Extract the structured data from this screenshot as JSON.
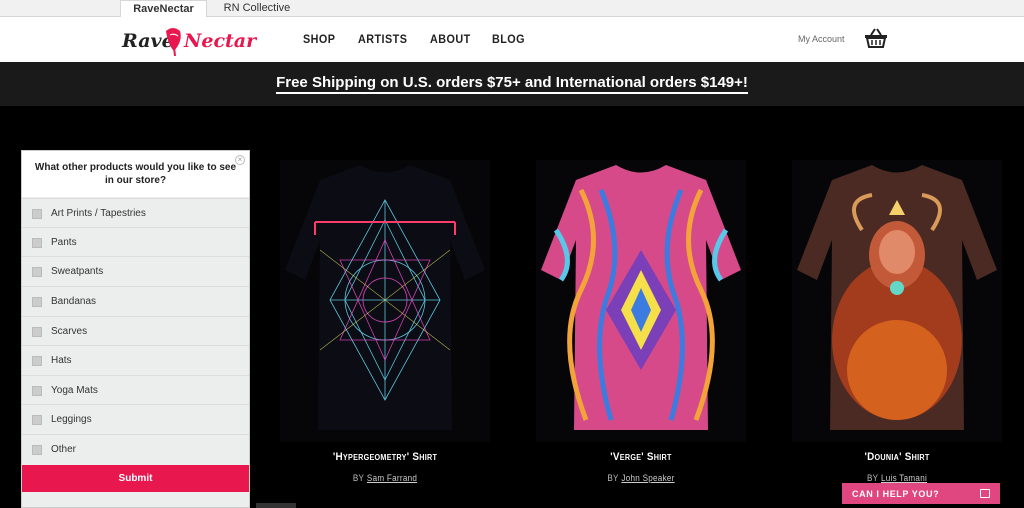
{
  "tabs": [
    {
      "label": "RaveNectar",
      "active": true
    },
    {
      "label": "RN Collective",
      "active": false
    }
  ],
  "header": {
    "logo_text_left": "Rave",
    "logo_text_right": "Nectar",
    "nav": [
      "SHOP",
      "ARTISTS",
      "ABOUT",
      "BLOG"
    ],
    "account_label": "My Account",
    "cart_icon": "basket-icon"
  },
  "banner": {
    "text": "Free Shipping on U.S. orders $75+ and International orders $149+!"
  },
  "survey": {
    "question": "What other products would you like to see in our store?",
    "close_icon": "close-icon",
    "options": [
      "Art Prints / Tapestries",
      "Pants",
      "Sweatpants",
      "Bandanas",
      "Scarves",
      "Hats",
      "Yoga Mats",
      "Leggings",
      "Other"
    ],
    "submit_label": "Submit"
  },
  "products": [
    {
      "title": "'Hypergeometry' Shirt",
      "by": "BY",
      "artist": "Sam Farrand"
    },
    {
      "title": "'Verge' Shirt",
      "by": "BY",
      "artist": "John Speaker"
    },
    {
      "title": "'Dounia' Shirt",
      "by": "BY",
      "artist": "Luis Tamani"
    }
  ],
  "chat": {
    "label": "CAN I HELP YOU?",
    "icon": "chat-window-icon"
  },
  "colors": {
    "accent": "#e8174e",
    "chat": "#e0467f",
    "banner_bg": "#1a1a1a"
  }
}
